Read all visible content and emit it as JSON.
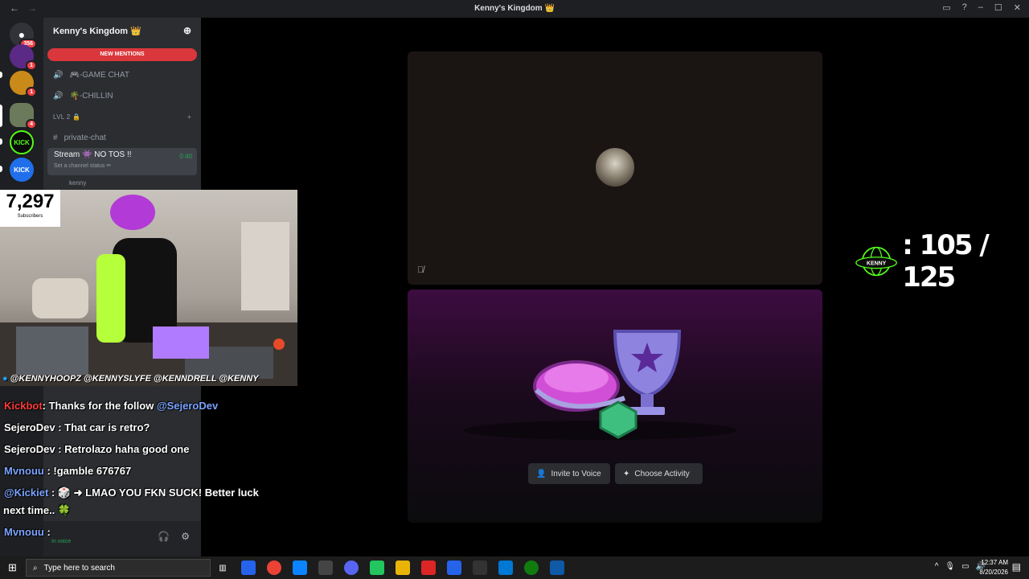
{
  "window": {
    "title": "Kenny's Kingdom 👑",
    "back": "←",
    "forward": "→",
    "controls": [
      "▭",
      "?",
      "–",
      "☐",
      "✕"
    ]
  },
  "rail": {
    "dm_badge": "356",
    "servers": [
      {
        "label": "",
        "badge": "1",
        "color": "#5b2a86"
      },
      {
        "label": "",
        "badge": "1",
        "color": "#c98a1a"
      },
      {
        "label": "",
        "badge": "4",
        "color": "#6b7a5a"
      },
      {
        "label": "KICK",
        "badge": "",
        "color": "#53fc18"
      },
      {
        "label": "KICK",
        "badge": "",
        "color": "#1f6feb"
      }
    ]
  },
  "sidebar": {
    "server_name": "Kenny's Kingdom 👑",
    "new_mentions": "NEW MENTIONS",
    "channels": [
      {
        "icon": "🔊",
        "name": "🎮-GAME CHAT"
      },
      {
        "icon": "🔊",
        "name": "🌴-CHILLIN"
      }
    ],
    "category": "LVL 2 🔒",
    "text_channel": "private-chat",
    "stream_channel": {
      "name": "Stream 👾 NO TOS !!",
      "timer": "0:40",
      "status": "Set a channel status ✏"
    },
    "voice_user": "kenny"
  },
  "user_panel": {
    "status": "In voice"
  },
  "stage": {
    "invite_label": "Invite to Voice",
    "activity_label": "Choose Activity"
  },
  "score": {
    "value": ": 105 / 125",
    "logo_text": "KENNY"
  },
  "webcam": {
    "subs_count": "7,297",
    "subs_label": "Subscribers",
    "socials": "@KENNYHOOPZ @KENNYSLYFE @KENNDRELL @KENNY"
  },
  "chat": [
    {
      "user": "Kickbot",
      "user_class": "u-kick",
      "text": ": Thanks for the follow ",
      "mention": "@SejeroDev"
    },
    {
      "user": "SejeroDev",
      "user_class": "",
      "text": " : That car is retro?",
      "mention": ""
    },
    {
      "user": "SejeroDev",
      "user_class": "",
      "text": " : Retrolazo haha good one",
      "mention": ""
    },
    {
      "user": "Mvnouu",
      "user_class": "u-blue",
      "text": " : !gamble 676767",
      "mention": ""
    },
    {
      "user": "@Kickiet",
      "user_class": "u-blue",
      "text": " : 🎲 ➜ LMAO YOU FKN SUCK! Better luck",
      "mention": ""
    },
    {
      "user": "",
      "user_class": "",
      "text": "next time.. 🍀",
      "mention": ""
    },
    {
      "user": "Mvnouu",
      "user_class": "u-blue",
      "text": " : ",
      "mention": ""
    }
  ],
  "taskbar": {
    "search_placeholder": "Type here to search",
    "time": "12:37 AM",
    "date": "8/20/2026"
  }
}
